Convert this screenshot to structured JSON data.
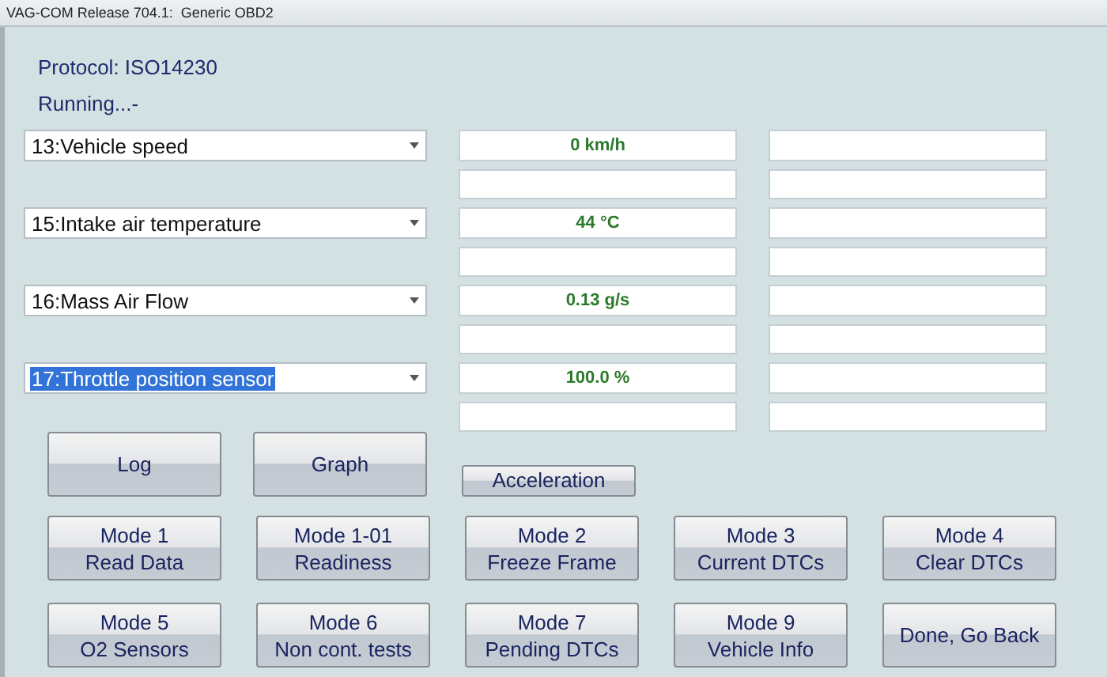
{
  "window": {
    "title": "VAG-COM Release 704.1:  Generic OBD2"
  },
  "protocol": "Protocol: ISO14230",
  "status": "Running...-",
  "sensors": [
    {
      "name": "13:Vehicle speed",
      "selected": false,
      "reading": "0 km/h"
    },
    {
      "name": "15:Intake air temperature",
      "selected": false,
      "reading": "44 °C"
    },
    {
      "name": "16:Mass Air Flow",
      "selected": false,
      "reading": "0.13 g/s"
    },
    {
      "name": "17:Throttle position sensor",
      "selected": true,
      "reading": "100.0 %"
    }
  ],
  "top_buttons": [
    {
      "label": "Log",
      "kind": "large"
    },
    {
      "label": "Graph",
      "kind": "large"
    },
    {
      "label": "Acceleration",
      "kind": "small"
    }
  ],
  "mode_buttons": [
    {
      "lines": [
        "Mode 1",
        "Read Data"
      ]
    },
    {
      "lines": [
        "Mode 1-01",
        "Readiness"
      ]
    },
    {
      "lines": [
        "Mode 2",
        "Freeze Frame"
      ]
    },
    {
      "lines": [
        "Mode 3",
        "Current DTCs"
      ]
    },
    {
      "lines": [
        "Mode 4",
        "Clear DTCs"
      ]
    },
    {
      "lines": [
        "Mode 5",
        "O2 Sensors"
      ]
    },
    {
      "lines": [
        "Mode 6",
        "Non cont. tests"
      ]
    },
    {
      "lines": [
        "Mode 7",
        "Pending DTCs"
      ]
    },
    {
      "lines": [
        "Mode 9",
        "Vehicle Info"
      ]
    },
    {
      "lines": [
        "Done, Go Back"
      ]
    }
  ]
}
